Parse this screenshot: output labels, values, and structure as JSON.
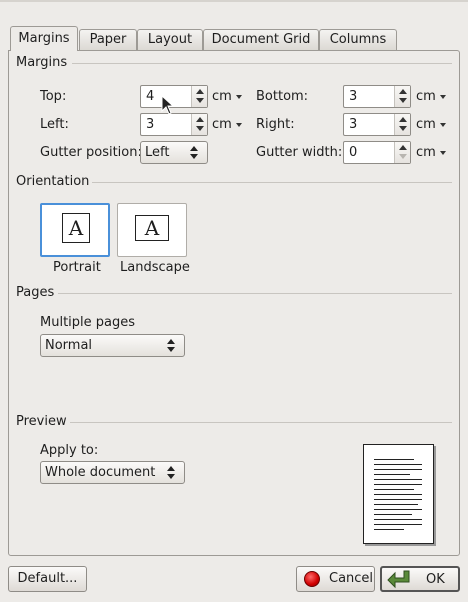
{
  "tabs": [
    "Margins",
    "Paper",
    "Layout",
    "Document Grid",
    "Columns"
  ],
  "margins": {
    "section": "Margins",
    "top": {
      "label": "Top:",
      "value": "4",
      "unit": "cm"
    },
    "left": {
      "label": "Left:",
      "value": "3",
      "unit": "cm"
    },
    "bottom": {
      "label": "Bottom:",
      "value": "3",
      "unit": "cm"
    },
    "right": {
      "label": "Right:",
      "value": "3",
      "unit": "cm"
    },
    "gutter_position": {
      "label": "Gutter position:",
      "value": "Left"
    },
    "gutter_width": {
      "label": "Gutter width:",
      "value": "0",
      "unit": "cm"
    }
  },
  "orientation": {
    "section": "Orientation",
    "portrait": "Portrait",
    "landscape": "Landscape",
    "icon_glyph": "A",
    "selected": "portrait"
  },
  "pages": {
    "section": "Pages",
    "multiple_label": "Multiple pages",
    "multiple_value": "Normal"
  },
  "preview": {
    "section": "Preview",
    "apply_label": "Apply to:",
    "apply_value": "Whole document"
  },
  "buttons": {
    "default": "Default...",
    "cancel": "Cancel",
    "ok": "OK"
  },
  "colors": {
    "background": "#edebe8",
    "selection": "#4a90d9",
    "cancel_icon": "#d10000",
    "ok_icon": "#5a8a3a"
  }
}
